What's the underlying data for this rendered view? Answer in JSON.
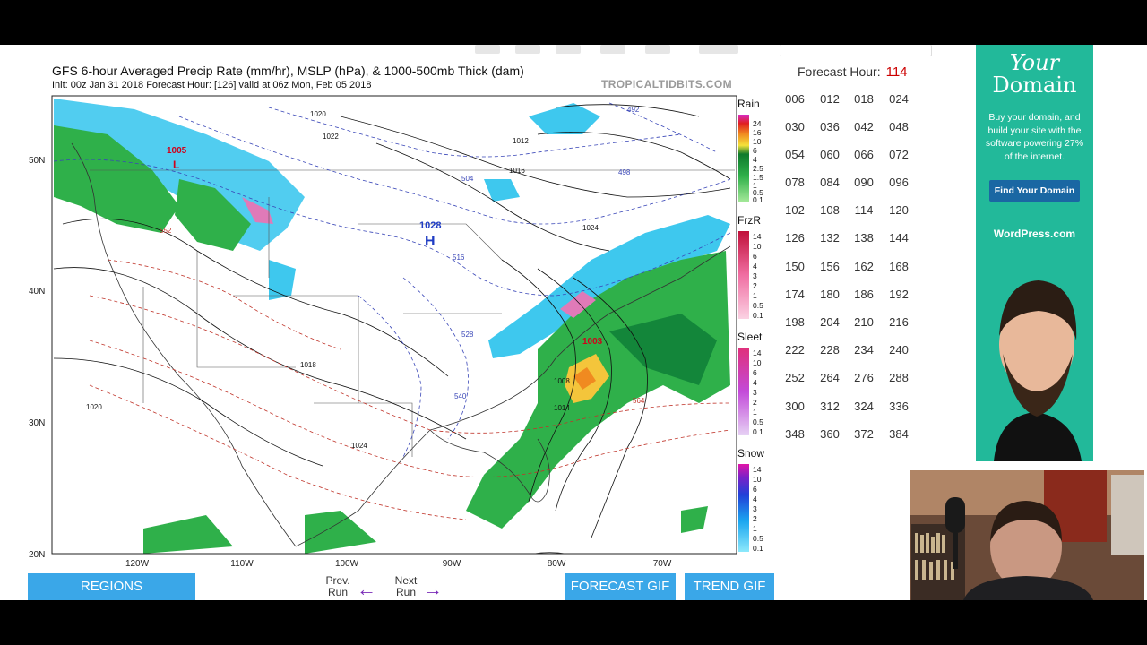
{
  "map": {
    "title": "GFS 6-hour Averaged Precip Rate (mm/hr), MSLP (hPa), & 1000-500mb Thick (dam)",
    "init": "Init: 00z Jan 31 2018   Forecast Hour: [126]   valid at 06z Mon, Feb 05 2018",
    "brand": "TROPICALTIDBITS.COM",
    "lat_labels": [
      "50N",
      "40N",
      "30N",
      "20N"
    ],
    "lon_labels": [
      "120W",
      "110W",
      "100W",
      "90W",
      "80W",
      "70W"
    ],
    "pressure_labels": [
      "1028",
      "1003",
      "1005"
    ],
    "high_symbol": "H",
    "low_symbol": "L",
    "isobar_labels": [
      "1020",
      "1022",
      "1016",
      "1012",
      "1024",
      "1018",
      "1014",
      "1008",
      "1020",
      "1024"
    ],
    "thickness_labels": [
      "504",
      "516",
      "528",
      "540",
      "552",
      "564",
      "492",
      "498"
    ],
    "legend": {
      "rain": {
        "label": "Rain",
        "values": [
          "24",
          "16",
          "10",
          "6",
          "4",
          "2.5",
          "1.5",
          "1",
          "0.5",
          "0.1"
        ]
      },
      "frzr": {
        "label": "FrzR",
        "values": [
          "14",
          "10",
          "6",
          "4",
          "3",
          "2",
          "1",
          "0.5",
          "0.1"
        ]
      },
      "sleet": {
        "label": "Sleet",
        "values": [
          "14",
          "10",
          "6",
          "4",
          "3",
          "2",
          "1",
          "0.5",
          "0.1"
        ]
      },
      "snow": {
        "label": "Snow",
        "values": [
          "14",
          "10",
          "6",
          "4",
          "3",
          "2",
          "1",
          "0.5",
          "0.1"
        ]
      }
    }
  },
  "forecast": {
    "label": "Forecast Hour:",
    "value": "114",
    "hours": [
      "006",
      "012",
      "018",
      "024",
      "030",
      "036",
      "042",
      "048",
      "054",
      "060",
      "066",
      "072",
      "078",
      "084",
      "090",
      "096",
      "102",
      "108",
      "114",
      "120",
      "126",
      "132",
      "138",
      "144",
      "150",
      "156",
      "162",
      "168",
      "174",
      "180",
      "186",
      "192",
      "198",
      "204",
      "210",
      "216",
      "222",
      "228",
      "234",
      "240",
      "252",
      "264",
      "276",
      "288",
      "300",
      "312",
      "324",
      "336",
      "348",
      "360",
      "372",
      "384"
    ]
  },
  "buttons": {
    "regions": "REGIONS",
    "prev_run": "Prev. Run",
    "next_run": "Next Run",
    "forecast_gif": "FORECAST GIF",
    "trend_gif": "TREND GIF"
  },
  "ad": {
    "headline1": "Your",
    "headline2": "Domain",
    "body": "Buy your domain, and build your site with the software powering 27% of the internet.",
    "cta": "Find Your Domain",
    "site": "WordPress.com"
  },
  "colors": {
    "button": "#3aa7e8",
    "snow": "#3ec8ee",
    "rain": "#2fb04a",
    "forecast_value": "#cc0000",
    "ad_bg": "#22b99a"
  }
}
